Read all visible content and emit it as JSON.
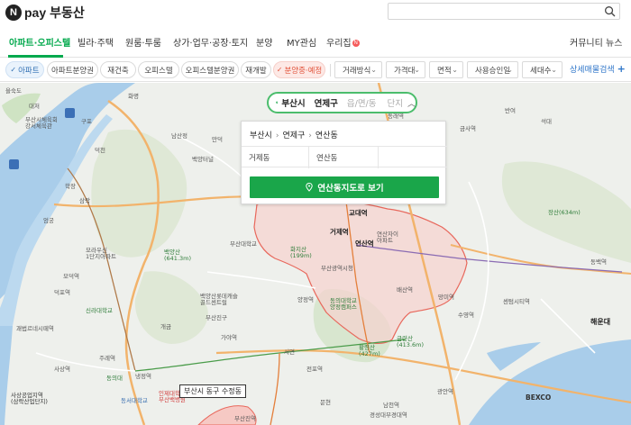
{
  "header": {
    "logo_letter": "N",
    "logo_pay": "pay",
    "logo_service": "부동산",
    "search_placeholder": ""
  },
  "nav": {
    "items": [
      "아파트·오피스텔",
      "빌라·주택",
      "원룸·투룸",
      "상가·업무·공장·토지",
      "분양",
      "MY관심",
      "우리집"
    ],
    "new_badge": "N",
    "right": [
      "커뮤니티",
      "뉴스"
    ]
  },
  "filters": {
    "chips": [
      "아파트",
      "아파트분양권",
      "재건축",
      "오피스텔",
      "오피스텔분양권",
      "재개발",
      "분양중·예정"
    ],
    "dropdowns": [
      "거래방식",
      "가격대",
      "면적",
      "사용승인일",
      "세대수"
    ],
    "detail_search": "상세매물검색",
    "plus": "+"
  },
  "region_selector": {
    "city": "부산시",
    "district": "연제구",
    "dong_tab": "읍/면/동",
    "complex_tab": "단지",
    "breadcrumb": [
      "부산시",
      "연제구",
      "연산동"
    ],
    "dongs": [
      "거제동",
      "연산동",
      ""
    ],
    "go_button": "연산동지도로 보기"
  },
  "map": {
    "tooltip": "부산시 동구 수정동",
    "labels": {
      "ulmukdo": "을숙도",
      "daejeo": "대저",
      "busan_sports": "부산시체육회\n강서체육관",
      "gupo": "구포",
      "hwamyeong": "화명",
      "deokcheon": "덕천",
      "mandeok": "만덕",
      "namsan": "남산정",
      "baekyang_tunnel": "백양터널",
      "baekyang": "백양산\n(641.3m)",
      "moraeushin": "모라우신\n1단지아파트",
      "baekyang_apt": "백양산롯데캐슬\n골드센트럴",
      "busan_nat_univ": "부산대학교",
      "sinla": "신라대학교",
      "gaya": "가야역",
      "gaegeum": "개금",
      "dongeui": "동의대",
      "seomyeon": "서면",
      "jeonpo": "전포역",
      "hwaji": "화지산\n(199m)",
      "gyodae": "교대역",
      "geoje": "거제역",
      "yeonsan": "연산역",
      "yeonsan_apt": "연산자이\n아파트",
      "busan_city_hall": "부산광역시청",
      "hwangnyeong": "황령산\n(427m)",
      "geumnyeon": "금련산\n(413.6m)",
      "suyeong": "수영역",
      "bexco": "BEXCO",
      "haeundae": "해운대",
      "jangsan": "장산(634m)",
      "banyeo": "반여",
      "seokdae": "석대",
      "geumsa": "금사역",
      "dongnae": "동래역",
      "minam": "미남",
      "baesan": "배산역",
      "mangmi": "망미역",
      "gwangan": "광안역",
      "namcheon": "남천역",
      "kyungsung": "경성대부경대역",
      "munhyeon": "문현",
      "busanjin": "부산진역",
      "sasang": "사상역",
      "gwaebeop": "괘법르네시떼역",
      "sasang_ind": "사상공업지역\n(삼락산업단지)",
      "dongseo": "동서대학교",
      "inje": "인제대학교\n부산백병원",
      "yangjeong": "양정역",
      "busan_gov": "부산시청",
      "haeundae_uni": "해운대구청",
      "centum": "센텀시티역",
      "dongbaek": "동백역",
      "sinseo": "신서면",
      "gukje": "동의대학교\n양정캠퍼스",
      "eomgung": "엄궁",
      "deokpo": "덕포역",
      "modeok": "모덕역",
      "jurye": "주례역",
      "naengjeong": "냉정역",
      "sinmu": "신무역",
      "busan_art": "부산예술중",
      "yeonje_gu": "부산진구",
      "samrak": "삼락",
      "hakjang": "학장"
    }
  }
}
